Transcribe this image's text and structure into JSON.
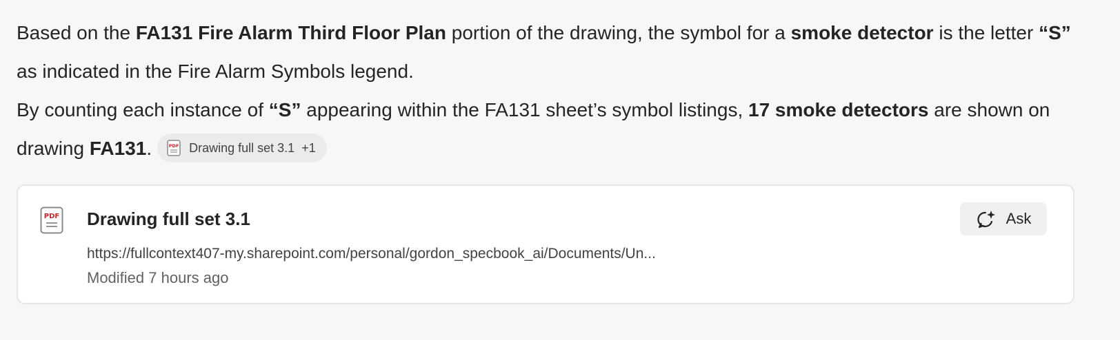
{
  "answer": {
    "p1": {
      "t1": "Based on the ",
      "b1": "FA131 Fire Alarm Third Floor Plan",
      "t2": " portion of the drawing, the symbol for a ",
      "b2": "smoke detector",
      "t3": " is the letter ",
      "b3": "“S”",
      "t4": " as indicated in the Fire Alarm Symbols legend."
    },
    "p2": {
      "t1": "By counting each instance of ",
      "b1": "“S”",
      "t2": " appearing within the FA131 sheet’s symbol listings, ",
      "b2": "17 smoke detectors",
      "t3": " are shown on drawing ",
      "b3": "FA131",
      "t4": "."
    },
    "citation": {
      "icon": "pdf-file-icon",
      "label": "Drawing full set 3.1",
      "extra": "+1"
    }
  },
  "reference_card": {
    "icon": "pdf-file-icon",
    "title": "Drawing full set 3.1",
    "url": "https://fullcontext407-my.sharepoint.com/personal/gordon_specbook_ai/Documents/Un...",
    "modified": "Modified 7 hours ago",
    "ask_button": {
      "icon": "sparkle-chat-icon",
      "label": "Ask"
    }
  },
  "colors": {
    "background": "#f7f7f7",
    "card_background": "#ffffff",
    "chip_background": "#ebebeb",
    "pdf_red": "#c4262e"
  }
}
